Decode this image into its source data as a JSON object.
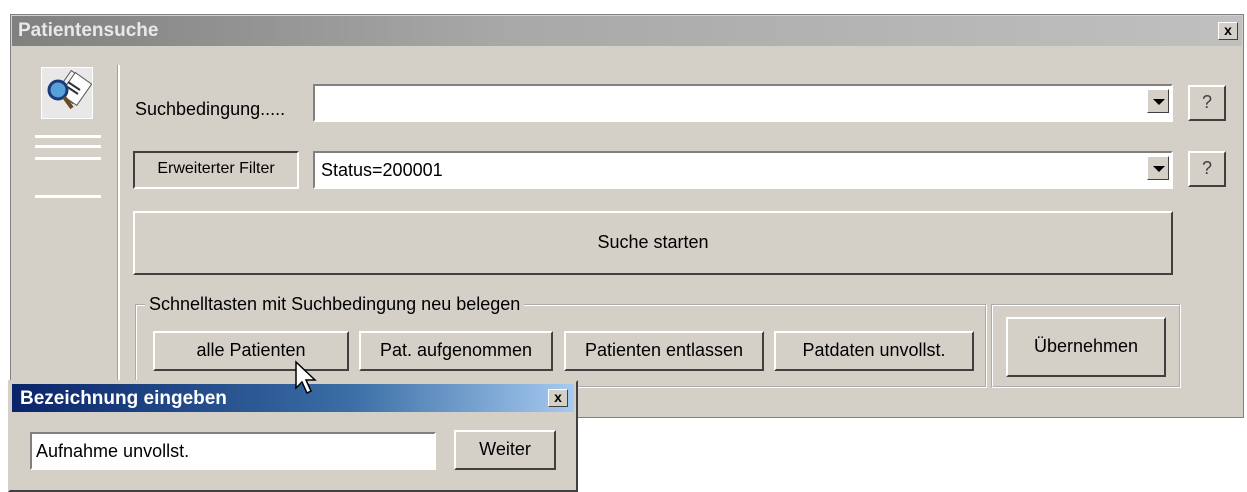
{
  "window": {
    "title": "Patientensuche",
    "close_label": "x"
  },
  "search": {
    "condition_label": "Suchbedingung.....",
    "condition_value": "",
    "help1": "?",
    "filter_button": "Erweiterter Filter",
    "filter_value": "Status=200001",
    "help2": "?",
    "start_button": "Suche starten"
  },
  "quick": {
    "group_label": "Schnelltasten mit Suchbedingung neu belegen",
    "buttons": [
      "alle Patienten",
      "Pat. aufgenommen",
      "Patienten entlassen",
      "Patdaten unvollst."
    ],
    "apply_button": "Übernehmen"
  },
  "dialog": {
    "title": "Bezeichnung eingeben",
    "close_label": "x",
    "input_value": "Aufnahme unvollst.",
    "next_button": "Weiter"
  }
}
